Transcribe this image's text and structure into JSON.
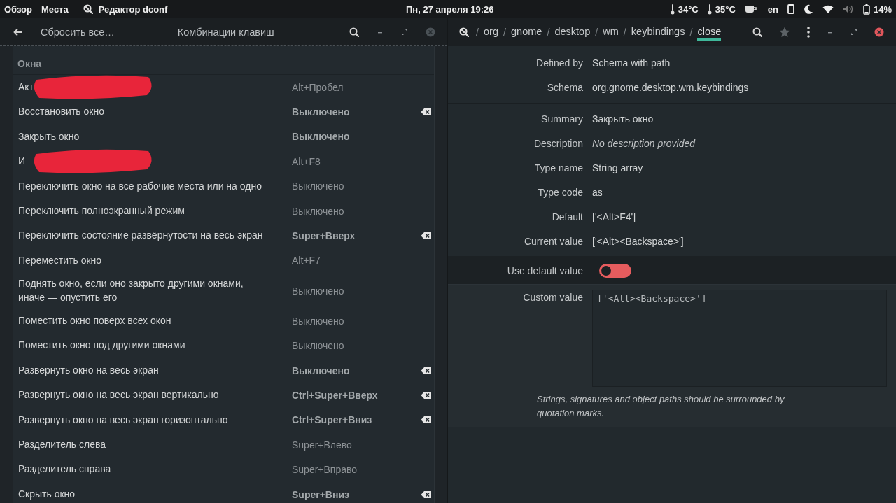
{
  "top_bar": {
    "left_items": [
      "Обзор",
      "Места"
    ],
    "app": "Редактор dconf",
    "clock": "Пн, 27 апреля  19:26",
    "temperatures": [
      "34°C",
      "35°C"
    ],
    "keyboard": "en",
    "battery": "14%"
  },
  "left_window": {
    "reset": "Сбросить все…",
    "title": "Комбинации клавиш",
    "section": "Окна",
    "rows": [
      {
        "name": "Акт",
        "shortcut": "Alt+Пробел",
        "bold": false,
        "clear": false,
        "redacted": true
      },
      {
        "name": "Восстановить окно",
        "shortcut": "Выключено",
        "bold": true,
        "clear": true,
        "redacted": false
      },
      {
        "name": "Закрыть окно",
        "shortcut": "Выключено",
        "bold": true,
        "clear": false,
        "redacted": false
      },
      {
        "name": "И",
        "shortcut": "Alt+F8",
        "bold": false,
        "clear": false,
        "redacted": true
      },
      {
        "name": "Переключить окно на все рабочие места или на одно",
        "shortcut": "Выключено",
        "bold": false,
        "clear": false,
        "redacted": false
      },
      {
        "name": "Переключить полноэкранный режим",
        "shortcut": "Выключено",
        "bold": false,
        "clear": false,
        "redacted": false
      },
      {
        "name": "Переключить состояние развёрнутости на весь экран",
        "shortcut": "Super+Вверх",
        "bold": true,
        "clear": true,
        "redacted": false
      },
      {
        "name": "Переместить окно",
        "shortcut": "Alt+F7",
        "bold": false,
        "clear": false,
        "redacted": false
      },
      {
        "name": "Поднять окно, если оно закрыто другими окнами, иначе — опустить его",
        "shortcut": "Выключено",
        "bold": false,
        "clear": false,
        "redacted": false
      },
      {
        "name": "Поместить окно поверх всех окон",
        "shortcut": "Выключено",
        "bold": false,
        "clear": false,
        "redacted": false
      },
      {
        "name": "Поместить окно под другими окнами",
        "shortcut": "Выключено",
        "bold": false,
        "clear": false,
        "redacted": false
      },
      {
        "name": "Развернуть окно на весь экран",
        "shortcut": "Выключено",
        "bold": true,
        "clear": true,
        "redacted": false
      },
      {
        "name": "Развернуть окно на весь экран вертикально",
        "shortcut": "Ctrl+Super+Вверх",
        "bold": true,
        "clear": true,
        "redacted": false
      },
      {
        "name": "Развернуть окно на весь экран горизонтально",
        "shortcut": "Ctrl+Super+Вниз",
        "bold": true,
        "clear": true,
        "redacted": false
      },
      {
        "name": "Разделитель слева",
        "shortcut": "Super+Влево",
        "bold": false,
        "clear": false,
        "redacted": false
      },
      {
        "name": "Разделитель справа",
        "shortcut": "Super+Вправо",
        "bold": false,
        "clear": false,
        "redacted": false
      },
      {
        "name": "Скрыть окно",
        "shortcut": "Super+Вниз",
        "bold": true,
        "clear": true,
        "redacted": false
      }
    ]
  },
  "right_window": {
    "separator": "/",
    "path": [
      {
        "text": "org",
        "selected": false
      },
      {
        "text": "gnome",
        "selected": false
      },
      {
        "text": "desktop",
        "selected": false
      },
      {
        "text": "wm",
        "selected": false
      },
      {
        "text": "keybindings",
        "selected": false
      },
      {
        "text": "close",
        "selected": true
      }
    ],
    "groups": [
      [
        {
          "label": "Defined by",
          "value": "Schema with path",
          "kind": "text"
        },
        {
          "label": "Schema",
          "value": "org.gnome.desktop.wm.keybindings",
          "kind": "text"
        }
      ],
      [
        {
          "label": "Summary",
          "value": "Закрыть окно",
          "kind": "text"
        },
        {
          "label": "Description",
          "value": "No description provided",
          "kind": "placeholder"
        },
        {
          "label": "Type name",
          "value": "String array",
          "kind": "text"
        },
        {
          "label": "Type code",
          "value": "as",
          "kind": "text"
        },
        {
          "label": "Default",
          "value": "['<Alt>F4']",
          "kind": "text"
        },
        {
          "label": "Current value",
          "value": "['<Alt><Backspace>']",
          "kind": "text"
        }
      ]
    ],
    "toggle": {
      "label": "Use default value",
      "on": false
    },
    "custom": {
      "label": "Custom value",
      "value": "['<Alt><Backspace>']"
    },
    "hint": "Strings, signatures and object paths should be surrounded by quotation marks."
  }
}
